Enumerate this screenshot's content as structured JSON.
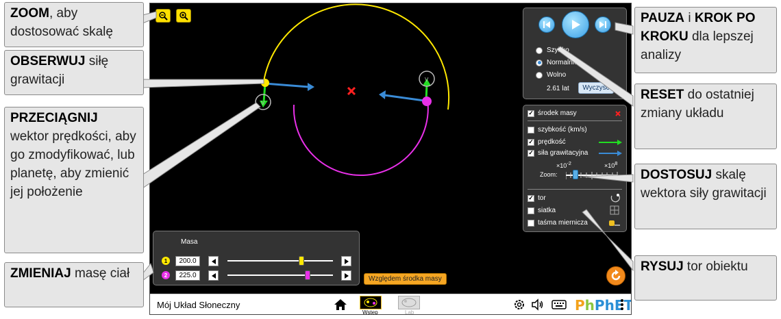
{
  "callouts": {
    "zoom": {
      "bold": "ZOOM",
      "rest": ", aby dostosować skalę"
    },
    "observe": {
      "bold": "OBSERWUJ",
      "rest": " siłę grawitacji"
    },
    "drag": {
      "bold": "PRZECIĄGNIJ",
      "rest": " wektor prędkości, aby go zmodyfikować, lub planetę, aby zmienić jej położenie"
    },
    "mass": {
      "bold": "ZMIENIAJ",
      "rest": " masę ciał"
    },
    "pause": {
      "bold1": "PAUZA",
      "mid": " i ",
      "bold2": "KROK PO KROKU",
      "rest": " dla lepszej analizy"
    },
    "reset": {
      "bold": "RESET",
      "rest": " do ostatniej zmiany układu"
    },
    "scale": {
      "bold": "DOSTOSUJ",
      "rest": " skalę wektora siły grawitacji"
    },
    "path": {
      "bold": "RYSUJ",
      "rest": " tor obiektu"
    }
  },
  "time_panel": {
    "speeds": [
      "Szybko",
      "Normalnie",
      "Wolno"
    ],
    "selected_speed": "Normalnie",
    "elapsed": "2.61 lat",
    "clear_label": "Wyczyść"
  },
  "options": {
    "center_of_mass": {
      "label": "środek masy",
      "checked": true
    },
    "speed": {
      "label": "szybkość (km/s)",
      "checked": false
    },
    "velocity": {
      "label": "prędkość",
      "checked": true
    },
    "gravity": {
      "label": "siła grawitacyjna",
      "checked": true
    },
    "zoom_label": "Zoom:",
    "zoom_min": "×10",
    "zoom_min_exp": "-2",
    "zoom_max": "×10",
    "zoom_max_exp": "8",
    "path": {
      "label": "tor",
      "checked": true
    },
    "grid": {
      "label": "siatka",
      "checked": false
    },
    "tape": {
      "label": "taśma miernicza",
      "checked": false
    }
  },
  "mass_panel": {
    "title": "Masa",
    "bodies": [
      {
        "index": "1",
        "value": "200.0",
        "color": "#ffe800",
        "level": 0.7
      },
      {
        "index": "2",
        "value": "225.0",
        "color": "#e830e8",
        "level": 0.76
      }
    ]
  },
  "center_button": "Względem środka masy",
  "navbar": {
    "title": "Mój Układ Słoneczny",
    "screens": [
      "Wstęp",
      "Lab"
    ],
    "logo": "PhET"
  },
  "colors": {
    "velocity": "#22dd22",
    "gravity": "#3a8bd6",
    "body1": "#ffe800",
    "body2": "#e830e8",
    "com": "#ff2020"
  }
}
